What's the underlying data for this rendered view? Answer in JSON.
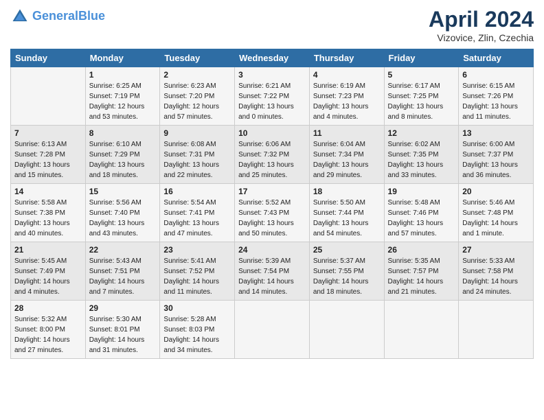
{
  "header": {
    "logo_line1": "General",
    "logo_line2": "Blue",
    "month_year": "April 2024",
    "location": "Vizovice, Zlin, Czechia"
  },
  "days_of_week": [
    "Sunday",
    "Monday",
    "Tuesday",
    "Wednesday",
    "Thursday",
    "Friday",
    "Saturday"
  ],
  "weeks": [
    [
      {
        "day": "",
        "info": ""
      },
      {
        "day": "1",
        "info": "Sunrise: 6:25 AM\nSunset: 7:19 PM\nDaylight: 12 hours\nand 53 minutes."
      },
      {
        "day": "2",
        "info": "Sunrise: 6:23 AM\nSunset: 7:20 PM\nDaylight: 12 hours\nand 57 minutes."
      },
      {
        "day": "3",
        "info": "Sunrise: 6:21 AM\nSunset: 7:22 PM\nDaylight: 13 hours\nand 0 minutes."
      },
      {
        "day": "4",
        "info": "Sunrise: 6:19 AM\nSunset: 7:23 PM\nDaylight: 13 hours\nand 4 minutes."
      },
      {
        "day": "5",
        "info": "Sunrise: 6:17 AM\nSunset: 7:25 PM\nDaylight: 13 hours\nand 8 minutes."
      },
      {
        "day": "6",
        "info": "Sunrise: 6:15 AM\nSunset: 7:26 PM\nDaylight: 13 hours\nand 11 minutes."
      }
    ],
    [
      {
        "day": "7",
        "info": "Sunrise: 6:13 AM\nSunset: 7:28 PM\nDaylight: 13 hours\nand 15 minutes."
      },
      {
        "day": "8",
        "info": "Sunrise: 6:10 AM\nSunset: 7:29 PM\nDaylight: 13 hours\nand 18 minutes."
      },
      {
        "day": "9",
        "info": "Sunrise: 6:08 AM\nSunset: 7:31 PM\nDaylight: 13 hours\nand 22 minutes."
      },
      {
        "day": "10",
        "info": "Sunrise: 6:06 AM\nSunset: 7:32 PM\nDaylight: 13 hours\nand 25 minutes."
      },
      {
        "day": "11",
        "info": "Sunrise: 6:04 AM\nSunset: 7:34 PM\nDaylight: 13 hours\nand 29 minutes."
      },
      {
        "day": "12",
        "info": "Sunrise: 6:02 AM\nSunset: 7:35 PM\nDaylight: 13 hours\nand 33 minutes."
      },
      {
        "day": "13",
        "info": "Sunrise: 6:00 AM\nSunset: 7:37 PM\nDaylight: 13 hours\nand 36 minutes."
      }
    ],
    [
      {
        "day": "14",
        "info": "Sunrise: 5:58 AM\nSunset: 7:38 PM\nDaylight: 13 hours\nand 40 minutes."
      },
      {
        "day": "15",
        "info": "Sunrise: 5:56 AM\nSunset: 7:40 PM\nDaylight: 13 hours\nand 43 minutes."
      },
      {
        "day": "16",
        "info": "Sunrise: 5:54 AM\nSunset: 7:41 PM\nDaylight: 13 hours\nand 47 minutes."
      },
      {
        "day": "17",
        "info": "Sunrise: 5:52 AM\nSunset: 7:43 PM\nDaylight: 13 hours\nand 50 minutes."
      },
      {
        "day": "18",
        "info": "Sunrise: 5:50 AM\nSunset: 7:44 PM\nDaylight: 13 hours\nand 54 minutes."
      },
      {
        "day": "19",
        "info": "Sunrise: 5:48 AM\nSunset: 7:46 PM\nDaylight: 13 hours\nand 57 minutes."
      },
      {
        "day": "20",
        "info": "Sunrise: 5:46 AM\nSunset: 7:48 PM\nDaylight: 14 hours\nand 1 minute."
      }
    ],
    [
      {
        "day": "21",
        "info": "Sunrise: 5:45 AM\nSunset: 7:49 PM\nDaylight: 14 hours\nand 4 minutes."
      },
      {
        "day": "22",
        "info": "Sunrise: 5:43 AM\nSunset: 7:51 PM\nDaylight: 14 hours\nand 7 minutes."
      },
      {
        "day": "23",
        "info": "Sunrise: 5:41 AM\nSunset: 7:52 PM\nDaylight: 14 hours\nand 11 minutes."
      },
      {
        "day": "24",
        "info": "Sunrise: 5:39 AM\nSunset: 7:54 PM\nDaylight: 14 hours\nand 14 minutes."
      },
      {
        "day": "25",
        "info": "Sunrise: 5:37 AM\nSunset: 7:55 PM\nDaylight: 14 hours\nand 18 minutes."
      },
      {
        "day": "26",
        "info": "Sunrise: 5:35 AM\nSunset: 7:57 PM\nDaylight: 14 hours\nand 21 minutes."
      },
      {
        "day": "27",
        "info": "Sunrise: 5:33 AM\nSunset: 7:58 PM\nDaylight: 14 hours\nand 24 minutes."
      }
    ],
    [
      {
        "day": "28",
        "info": "Sunrise: 5:32 AM\nSunset: 8:00 PM\nDaylight: 14 hours\nand 27 minutes."
      },
      {
        "day": "29",
        "info": "Sunrise: 5:30 AM\nSunset: 8:01 PM\nDaylight: 14 hours\nand 31 minutes."
      },
      {
        "day": "30",
        "info": "Sunrise: 5:28 AM\nSunset: 8:03 PM\nDaylight: 14 hours\nand 34 minutes."
      },
      {
        "day": "",
        "info": ""
      },
      {
        "day": "",
        "info": ""
      },
      {
        "day": "",
        "info": ""
      },
      {
        "day": "",
        "info": ""
      }
    ]
  ]
}
